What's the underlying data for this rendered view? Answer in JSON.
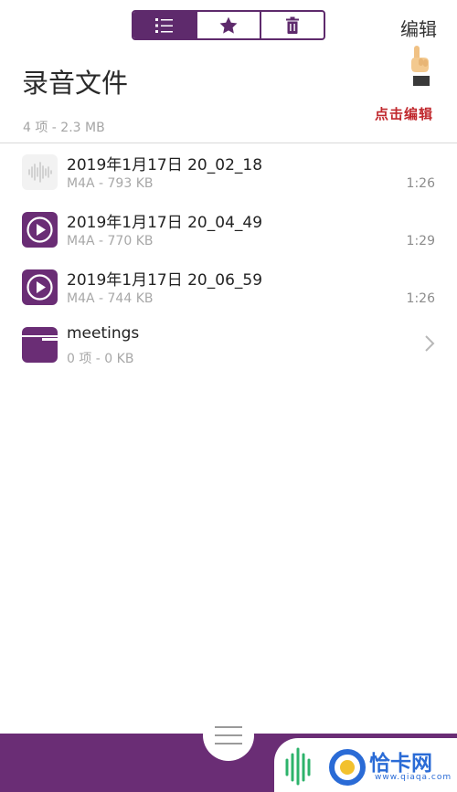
{
  "header": {
    "edit_label": "编辑",
    "tabs": [
      {
        "name": "list",
        "icon": "list-icon",
        "active": true
      },
      {
        "name": "favorites",
        "icon": "star-icon",
        "active": false
      },
      {
        "name": "trash",
        "icon": "trash-icon",
        "active": false
      }
    ],
    "hint": "点击编辑"
  },
  "page": {
    "title": "录音文件",
    "summary": "4 项 - 2.3 MB"
  },
  "items": [
    {
      "icon": "waveform-icon",
      "title": "2019年1月17日 20_02_18",
      "meta": "M4A - 793 KB",
      "duration": "1:26"
    },
    {
      "icon": "play-icon",
      "title": "2019年1月17日 20_04_49",
      "meta": "M4A - 770 KB",
      "duration": "1:29"
    },
    {
      "icon": "play-icon",
      "title": "2019年1月17日 20_06_59",
      "meta": "M4A - 744 KB",
      "duration": "1:26"
    },
    {
      "icon": "folder-icon",
      "title": "meetings",
      "meta": "0 项 - 0 KB",
      "duration": ""
    }
  ],
  "bottom": {
    "menu_icon": "hamburger-menu-icon"
  },
  "watermark": {
    "brand": "恰卡网",
    "url": "www.qiaqa.com"
  },
  "colors": {
    "accent": "#6a2d75",
    "hint_red": "#c0282d"
  }
}
